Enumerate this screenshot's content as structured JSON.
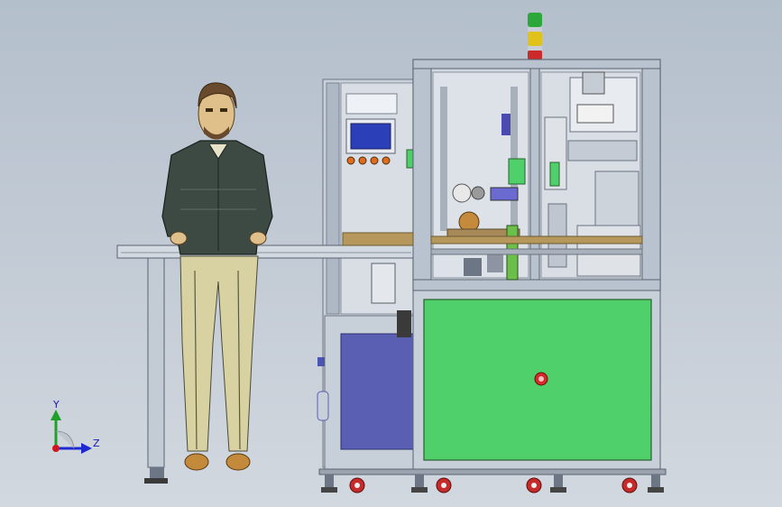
{
  "viewport": {
    "background_top": "#b4bfcc",
    "background_bottom": "#d2d8df"
  },
  "triad": {
    "y_label": "Y",
    "z_label": "Z",
    "y_color": "#1fa02a",
    "z_color": "#1e2ad0",
    "x_color": "#d0161e"
  },
  "machine": {
    "frame_color": "#b9c3cf",
    "lower_panel_left_color": "#5b5fb4",
    "lower_panel_right_color": "#4fd06a",
    "hmi_screen_color": "#2a3fb8",
    "tower_light_colors": [
      "#2ca83a",
      "#e0c21a",
      "#cc2a2a"
    ],
    "stop_button_color": "#d62a2a"
  },
  "figure": {
    "jacket_color": "#3d4a44",
    "pants_color": "#d8d2a2",
    "shoe_color": "#c48a3c",
    "hair_color": "#6a4a2c"
  }
}
